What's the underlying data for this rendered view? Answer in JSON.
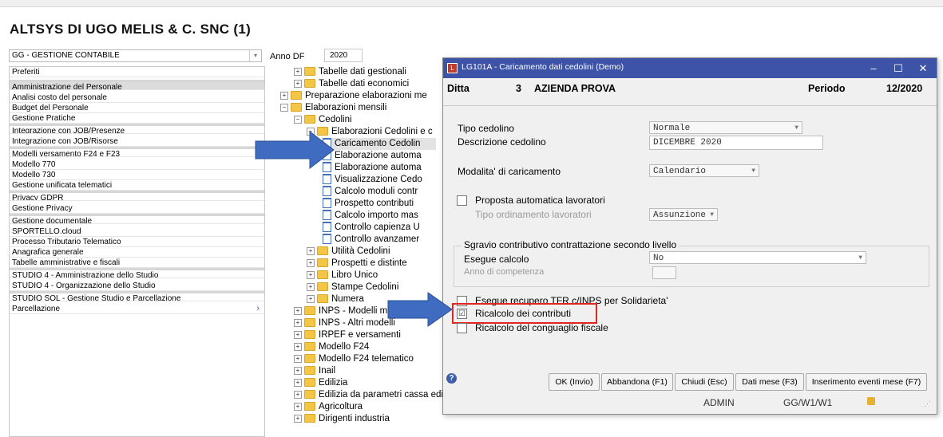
{
  "company_title": "ALTSYS DI UGO MELIS & C. SNC (1)",
  "module_select": {
    "value": "GG - GESTIONE CONTABILE"
  },
  "anno_df": {
    "label": "Anno DF",
    "value": "2020"
  },
  "left_menu": [
    {
      "label": "Preferiti"
    },
    {
      "label": "Amministrazione del Personale"
    },
    {
      "label": "Analisi costo del personale"
    },
    {
      "label": "Budget del Personale"
    },
    {
      "label": "Gestione Pratiche"
    },
    {
      "label": "Integrazione con JOB/Presenze"
    },
    {
      "label": "Integrazione con JOB/Risorse"
    },
    {
      "label": "Modelli versamento F24 e F23"
    },
    {
      "label": "Modello 770"
    },
    {
      "label": "Modello 730"
    },
    {
      "label": "Gestione unificata telematici"
    },
    {
      "label": "Privacy GDPR"
    },
    {
      "label": "Gestione Privacy"
    },
    {
      "label": "Gestione documentale"
    },
    {
      "label": "SPORTELLO.cloud"
    },
    {
      "label": "Processo Tributario Telematico"
    },
    {
      "label": "Anagrafica generale"
    },
    {
      "label": "Tabelle amministrative e fiscali"
    },
    {
      "label": "STUDIO 4 - Amministrazione dello Studio"
    },
    {
      "label": "STUDIO 4 - Organizzazione dello Studio"
    },
    {
      "label": "STUDIO SQL - Gestione Studio e Parcellazione"
    },
    {
      "label": "Parcellazione"
    }
  ],
  "tree": [
    {
      "label": "Tabelle dati gestionali"
    },
    {
      "label": "Tabelle dati economici"
    },
    {
      "label": "Preparazione elaborazioni me"
    },
    {
      "label": "Elaborazioni mensili"
    },
    {
      "label": "Cedolini"
    },
    {
      "label": "Elaborazioni Cedolini e c"
    },
    {
      "label": "Caricamento Cedolin"
    },
    {
      "label": "Elaborazione automa"
    },
    {
      "label": "Elaborazione automa"
    },
    {
      "label": "Visualizzazione Cedo"
    },
    {
      "label": "Calcolo moduli contr"
    },
    {
      "label": "Prospetto contributi"
    },
    {
      "label": "Calcolo importo mas"
    },
    {
      "label": "Controllo capienza U"
    },
    {
      "label": "Controllo avanzamer"
    },
    {
      "label": "Utilità Cedolini"
    },
    {
      "label": "Prospetti e distinte"
    },
    {
      "label": "Libro Unico"
    },
    {
      "label": "Stampe Cedolini"
    },
    {
      "label": "Numera"
    },
    {
      "label": "INPS - Modelli mensili"
    },
    {
      "label": "INPS - Altri modelli"
    },
    {
      "label": "IRPEF e versamenti"
    },
    {
      "label": "Modello F24"
    },
    {
      "label": "Modello F24 telematico"
    },
    {
      "label": "Inail"
    },
    {
      "label": "Edilizia"
    },
    {
      "label": "Edilizia da parametri cassa edile"
    },
    {
      "label": "Agricoltura"
    },
    {
      "label": "Dirigenti industria"
    }
  ],
  "dialog": {
    "title": "LG101A - Caricamento dati cedolini  (Demo)",
    "ditta_label": "Ditta",
    "ditta_num": "3",
    "ditta_name": "AZIENDA PROVA",
    "periodo_label": "Periodo",
    "periodo_value": "12/2020",
    "tipo_cedolino_label": "Tipo cedolino",
    "tipo_cedolino_value": "Normale",
    "descrizione_label": "Descrizione cedolino",
    "descrizione_value": "DICEMBRE 2020",
    "modalita_label": "Modalita' di caricamento",
    "modalita_value": "Calendario",
    "proposta_label": "Proposta automatica lavoratori",
    "tipo_ordinamento_label": "Tipo ordinamento lavoratori",
    "tipo_ordinamento_value": "Assunzione",
    "sgravio_title": "Sgravio contributivo contrattazione secondo livello",
    "esegue_calcolo_label": "Esegue calcolo",
    "esegue_calcolo_value": "No",
    "anno_competenza_label": "Anno di competenza",
    "tfr_label": "Esegue recupero TFR c/INPS per Solidarieta'",
    "ricalcolo_contributi_label": "Ricalcolo dei contributi",
    "ricalcolo_contributi_checked": "☑",
    "ricalcolo_conguaglio_label": "Ricalcolo del conguaglio fiscale",
    "buttons": {
      "ok": "OK (Invio)",
      "abbandona": "Abbandona (F1)",
      "chiudi": "Chiudi (Esc)",
      "dati_mese": "Dati mese (F3)",
      "inserimento": "Inserimento eventi mese (F7)"
    },
    "status_user": "ADMIN",
    "status_path": "GG/W1/W1"
  },
  "colors": {
    "titlebar": "#3c53a7",
    "arrow": "#3f6cc1",
    "highlight": "#e0261f"
  }
}
